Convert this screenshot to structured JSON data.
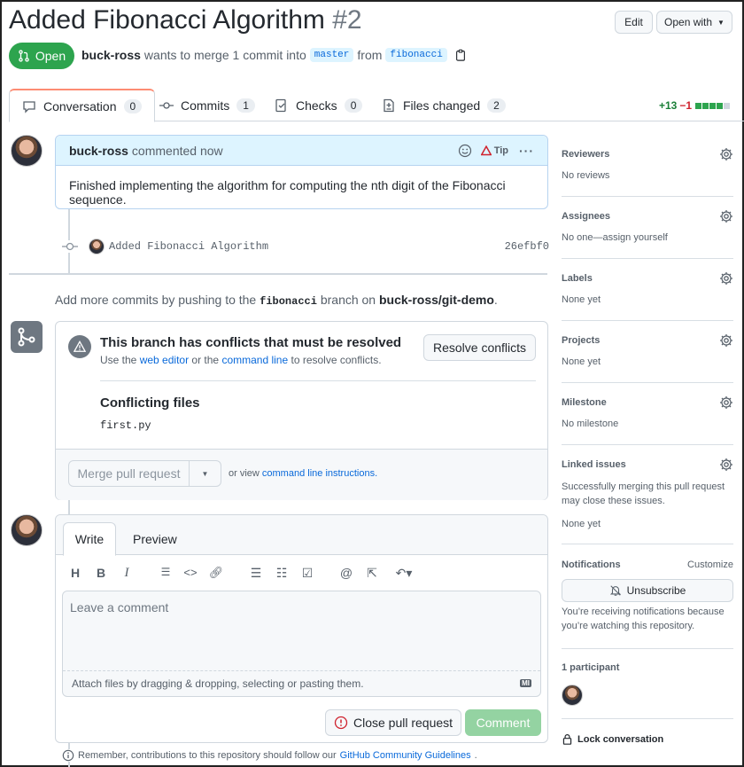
{
  "pr": {
    "title": "Added Fibonacci Algorithm",
    "number": "#2",
    "state": "Open",
    "author": "buck-ross",
    "merge_text": "wants to merge 1 commit into",
    "base_branch": "master",
    "from_text": "from",
    "head_branch": "fibonacci"
  },
  "header": {
    "edit_label": "Edit",
    "open_with_label": "Open with"
  },
  "tabs": [
    {
      "label": "Conversation",
      "count": "0"
    },
    {
      "label": "Commits",
      "count": "1"
    },
    {
      "label": "Checks",
      "count": "0"
    },
    {
      "label": "Files changed",
      "count": "2"
    }
  ],
  "diffstat": {
    "additions": "+13",
    "deletions": "−1"
  },
  "comment": {
    "author": "buck-ross",
    "time": "commented now",
    "tip_label": "Tip",
    "body": "Finished implementing the algorithm for computing the nth digit of the Fibonacci sequence."
  },
  "commit": {
    "message": "Added Fibonacci Algorithm",
    "sha": "26efbf0"
  },
  "push_hint": {
    "prefix": "Add more commits by pushing to the",
    "branch": "fibonacci",
    "middle": "branch on",
    "repo": "buck-ross/git-demo",
    "suffix": "."
  },
  "merge": {
    "conflict_title": "This branch has conflicts that must be resolved",
    "conflict_sub_1": "Use the",
    "web_editor": "web editor",
    "conflict_sub_2": "or the",
    "command_line": "command line",
    "conflict_sub_3": "to resolve conflicts.",
    "resolve_label": "Resolve conflicts",
    "conflicting_title": "Conflicting files",
    "conflicting_file": "first.py",
    "merge_button": "Merge pull request",
    "or_view": "or view",
    "instructions": "command line instructions."
  },
  "editor": {
    "write_tab": "Write",
    "preview_tab": "Preview",
    "placeholder": "Leave a comment",
    "attach_text": "Attach files by dragging & dropping, selecting or pasting them.",
    "md_badge": "MI",
    "close_label": "Close pull request",
    "comment_label": "Comment",
    "remember_prefix": "Remember, contributions to this repository should follow our",
    "guidelines": "GitHub Community Guidelines",
    "remember_suffix": "."
  },
  "sidebar": {
    "reviewers": {
      "label": "Reviewers",
      "value": "No reviews"
    },
    "assignees": {
      "label": "Assignees",
      "value": "No one—assign yourself"
    },
    "labels": {
      "label": "Labels",
      "value": "None yet"
    },
    "projects": {
      "label": "Projects",
      "value": "None yet"
    },
    "milestone": {
      "label": "Milestone",
      "value": "No milestone"
    },
    "linked": {
      "label": "Linked issues",
      "desc_1": "Successfully merging this pull request",
      "desc_2": "may close these issues.",
      "value": "None yet"
    },
    "notifications": {
      "label": "Notifications",
      "customize": "Customize",
      "unsubscribe": "Unsubscribe",
      "desc_1": "You’re receiving notifications because",
      "desc_2": "you’re watching this repository."
    },
    "participants": {
      "label": "1 participant"
    },
    "lock": {
      "label": "Lock conversation"
    }
  },
  "colors": {
    "open_green": "#2da44e",
    "link_blue": "#0969da",
    "comment_header": "#ddf4ff",
    "tab_accent": "#fd8c73"
  }
}
